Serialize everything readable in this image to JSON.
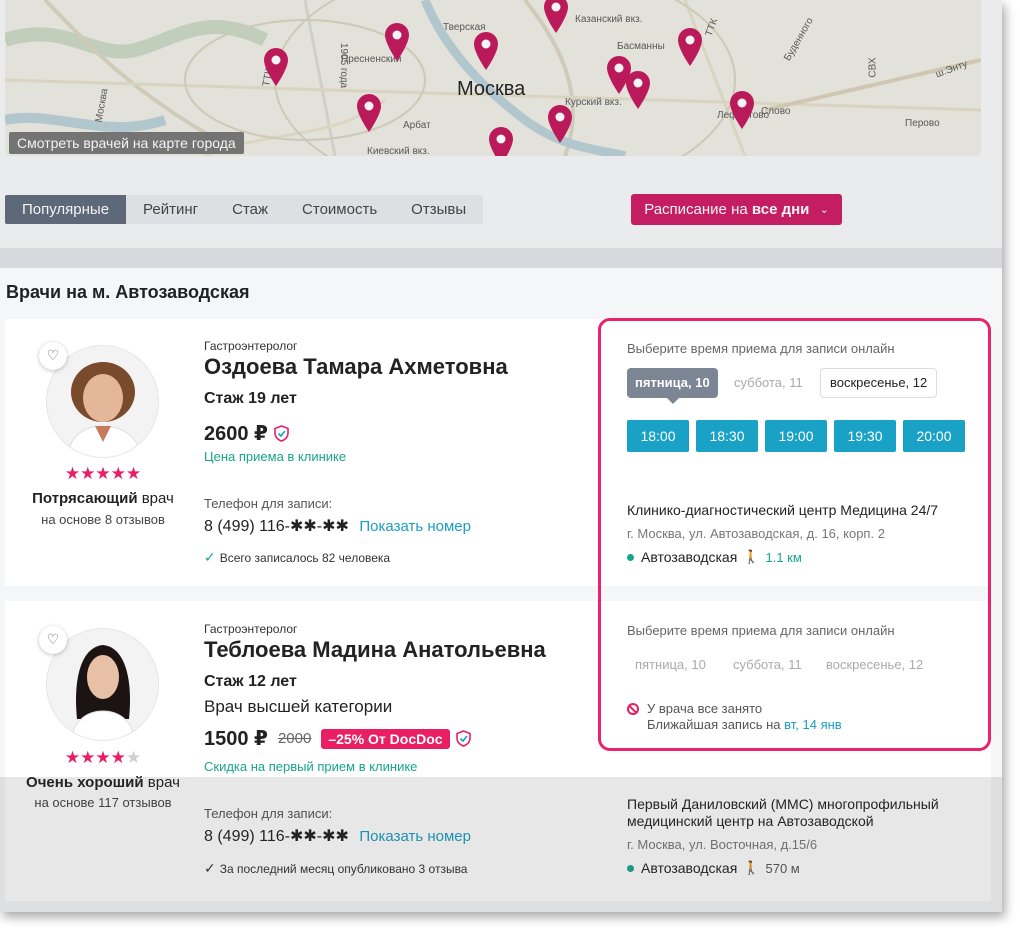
{
  "map": {
    "city": "Москва",
    "link": "Смотреть врачей на карте города",
    "labels": [
      "Тверская",
      "Казанский вкз.",
      "Пресненский",
      "Басманны",
      "Буденного",
      "ш.Энту",
      "Курский вкз.",
      "Арбат",
      "Киевский вкз.",
      "Лефортово",
      "Перово",
      "1905 года",
      "Москва",
      "ТТК",
      "СВХ",
      "ТТК",
      "Слово"
    ],
    "pin_color": "#c2185b"
  },
  "sort": {
    "tabs": [
      "Популярные",
      "Рейтинг",
      "Стаж",
      "Стоимость",
      "Отзывы"
    ],
    "active": 0,
    "schedule_prefix": "Расписание на",
    "schedule_bold": "все дни"
  },
  "heading": "Врачи на м. Автозаводская",
  "doctors": [
    {
      "specialty": "Гастроэнтеролог",
      "name": "Оздоева Тамара Ахметовна",
      "experience": "Стаж 19 лет",
      "price": "2600 ₽",
      "price_note": "Цена приема в клинике",
      "stars": "★★★★★",
      "rating_value": 4.5,
      "rating_word": "Потрясающий",
      "rating_suffix": " врач",
      "reviews": "на основе 8 отзывов",
      "phone_label": "Телефон для записи:",
      "phone": "8 (499) 116-✱✱-✱✱",
      "show_phone": "Показать номер",
      "note": "Всего записалось 82 человека",
      "slots_title": "Выберите время приема для записи онлайн",
      "days": [
        "пятница, 10",
        "суббота, 11",
        "воскресенье, 12"
      ],
      "times": [
        "18:00",
        "18:30",
        "19:00",
        "19:30",
        "20:00"
      ],
      "clinic": "Клинико-диагностический центр Медицина 24/7",
      "address": "г. Москва, ул. Автозаводская, д. 16, корп. 2",
      "metro": "Автозаводская",
      "distance": "1.1 км"
    },
    {
      "specialty": "Гастроэнтеролог",
      "name": "Теблоева Мадина Анатольевна",
      "experience": "Стаж 12 лет",
      "category": "Врач высшей категории",
      "price": "1500 ₽",
      "old_price": "2000",
      "discount": "–25% От DocDoc",
      "price_note": "Скидка на первый прием в клинике",
      "stars_on": "★★★★",
      "stars_off": "★",
      "rating_value": 4,
      "rating_word": "Очень хороший",
      "rating_suffix": " врач",
      "reviews": "на основе 117 отзывов",
      "phone_label": "Телефон для записи:",
      "phone": "8 (499) 116-✱✱-✱✱",
      "show_phone": "Показать номер",
      "note": "За последний месяц опубликовано 3 отзыва",
      "slots_title": "Выберите время приема для записи онлайн",
      "days": [
        "пятница, 10",
        "суббота, 11",
        "воскресенье, 12"
      ],
      "busy": "У врача все занято",
      "nearest_prefix": "Ближайшая запись на ",
      "nearest_date": "вт, 14 янв",
      "clinic": "Первый Даниловский (ММС) многопрофильный медицинский центр на Автозаводской",
      "address": "г. Москва, ул. Восточная, д.15/6",
      "metro": "Автозаводская",
      "distance": "570 м"
    }
  ],
  "colors": {
    "accent": "#ce1b63",
    "slot": "#19a2c5",
    "green": "#17a589",
    "highlight": "#e8246c"
  }
}
